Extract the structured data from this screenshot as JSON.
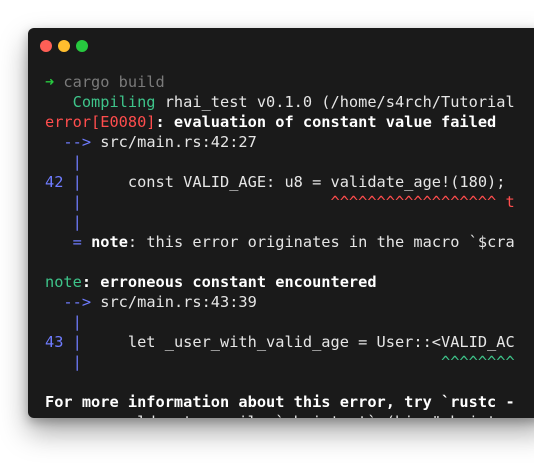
{
  "window": {
    "buttons": [
      {
        "name": "close",
        "color": "#ff5f56"
      },
      {
        "name": "minimize",
        "color": "#ffbd2e"
      },
      {
        "name": "maximize",
        "color": "#27c93f"
      }
    ]
  },
  "colors": {
    "background": "#1a1a1a",
    "text": "#e6e6e6",
    "prompt_arrow": "#27c93f",
    "muted": "#7a7a7a",
    "success": "#3ec48a",
    "error": "#ff4d4d",
    "info": "#6f7cff"
  },
  "terminal": {
    "lines": [
      [
        {
          "t": "➜ ",
          "c": "#27c93f"
        },
        {
          "t": "cargo build",
          "c": "#7a7a7a"
        }
      ],
      [
        {
          "t": "   Compiling",
          "c": "#3ec48a"
        },
        {
          "t": " rhai_test v0.1.0 (/home/s4rch/Tutorial",
          "c": "#e6e6e6"
        }
      ],
      [
        {
          "t": "error[E0080]",
          "c": "#ff4d4d"
        },
        {
          "t": ": evaluation of constant value failed",
          "c": "#ffffff",
          "b": true
        }
      ],
      [
        {
          "t": "  --> ",
          "c": "#6f7cff"
        },
        {
          "t": "src/main.rs:42:27",
          "c": "#e6e6e6"
        }
      ],
      [
        {
          "t": "   |",
          "c": "#6f7cff"
        }
      ],
      [
        {
          "t": "42 |",
          "c": "#6f7cff"
        },
        {
          "t": "     const VALID_AGE: u8 = validate_age!(180);",
          "c": "#e6e6e6"
        }
      ],
      [
        {
          "t": "   |",
          "c": "#6f7cff"
        },
        {
          "t": "                           ^^^^^^^^^^^^^^^^^^ t",
          "c": "#ff4d4d"
        }
      ],
      [
        {
          "t": "   |",
          "c": "#6f7cff"
        }
      ],
      [
        {
          "t": "   = ",
          "c": "#6f7cff"
        },
        {
          "t": "note",
          "c": "#ffffff",
          "b": true
        },
        {
          "t": ": this error originates in the macro `$cra",
          "c": "#e6e6e6"
        }
      ],
      [],
      [
        {
          "t": "note",
          "c": "#3ec48a"
        },
        {
          "t": ": erroneous constant encountered",
          "c": "#ffffff",
          "b": true
        }
      ],
      [
        {
          "t": "  --> ",
          "c": "#6f7cff"
        },
        {
          "t": "src/main.rs:43:39",
          "c": "#e6e6e6"
        }
      ],
      [
        {
          "t": "   |",
          "c": "#6f7cff"
        }
      ],
      [
        {
          "t": "43 |",
          "c": "#6f7cff"
        },
        {
          "t": "     let _user_with_valid_age = User::<VALID_AC",
          "c": "#e6e6e6"
        }
      ],
      [
        {
          "t": "   |",
          "c": "#6f7cff"
        },
        {
          "t": "                                       ^^^^^^^^",
          "c": "#3ec48a"
        }
      ],
      [],
      [
        {
          "t": "For more information about this error, try `rustc -",
          "c": "#ffffff",
          "b": true
        }
      ],
      [
        {
          "t": "error",
          "c": "#ff4d4d"
        },
        {
          "t": ": could not compile `rhai_test` (bin \"rhai_tes",
          "c": "#e6e6e6"
        }
      ]
    ]
  }
}
